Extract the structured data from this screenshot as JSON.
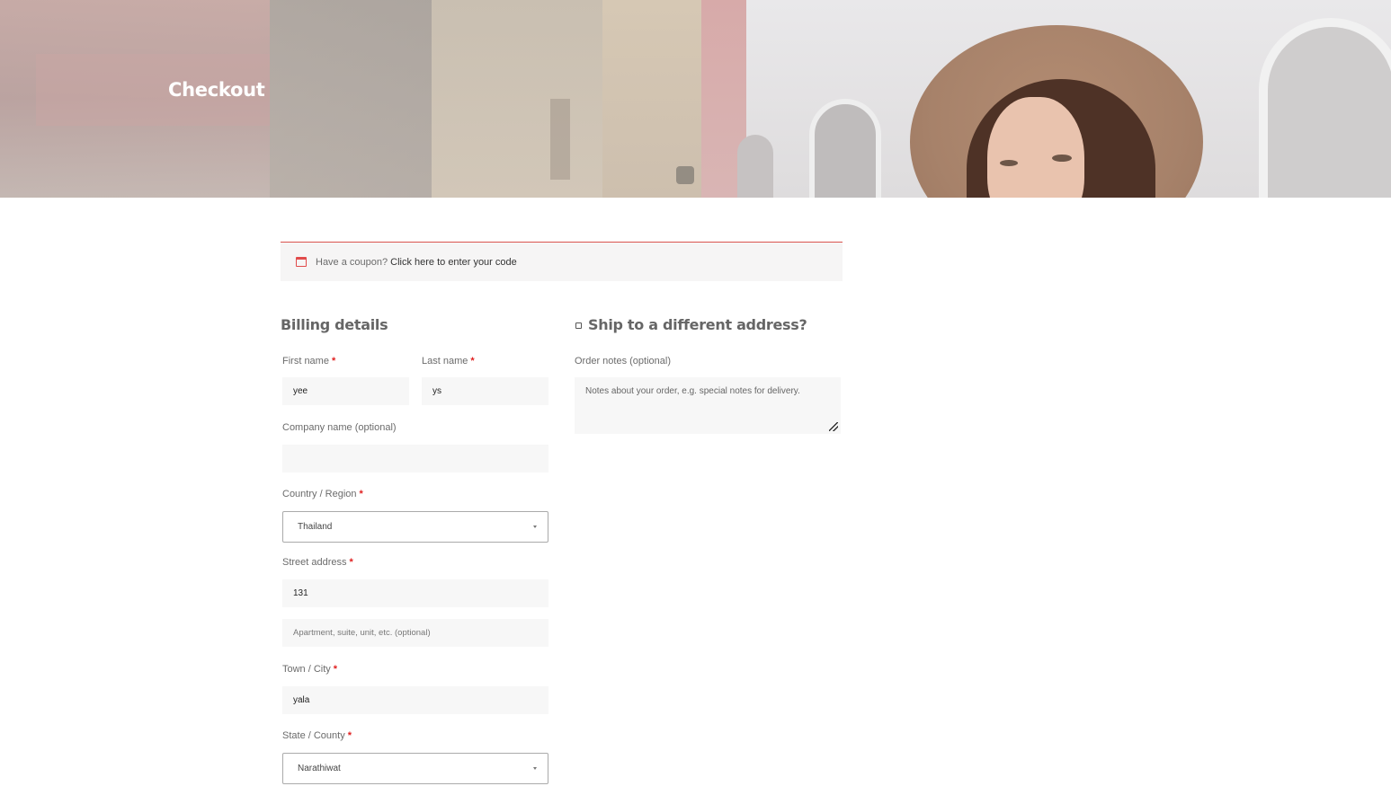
{
  "hero": {
    "title": "Checkout"
  },
  "coupon": {
    "prompt": "Have a coupon?",
    "link": "Click here to enter your code"
  },
  "billing": {
    "heading": "Billing details",
    "first_name": {
      "label": "First name",
      "required": "*",
      "value": "yee"
    },
    "last_name": {
      "label": "Last name",
      "required": "*",
      "value": "ys"
    },
    "company": {
      "label": "Company name (optional)",
      "value": ""
    },
    "country": {
      "label": "Country / Region",
      "required": "*",
      "value": "Thailand"
    },
    "street": {
      "label": "Street address",
      "required": "*",
      "value": "131",
      "placeholder2": "Apartment, suite, unit, etc. (optional)"
    },
    "city": {
      "label": "Town / City",
      "required": "*",
      "value": "yala"
    },
    "state": {
      "label": "State / County",
      "required": "*",
      "value": "Narathiwat"
    }
  },
  "shipping": {
    "heading": "Ship to a different address?",
    "order_notes": {
      "label": "Order notes (optional)",
      "placeholder": "Notes about your order, e.g. special notes for delivery."
    }
  },
  "colors": {
    "accent": "#e02020",
    "field_bg": "#f7f7f7"
  }
}
